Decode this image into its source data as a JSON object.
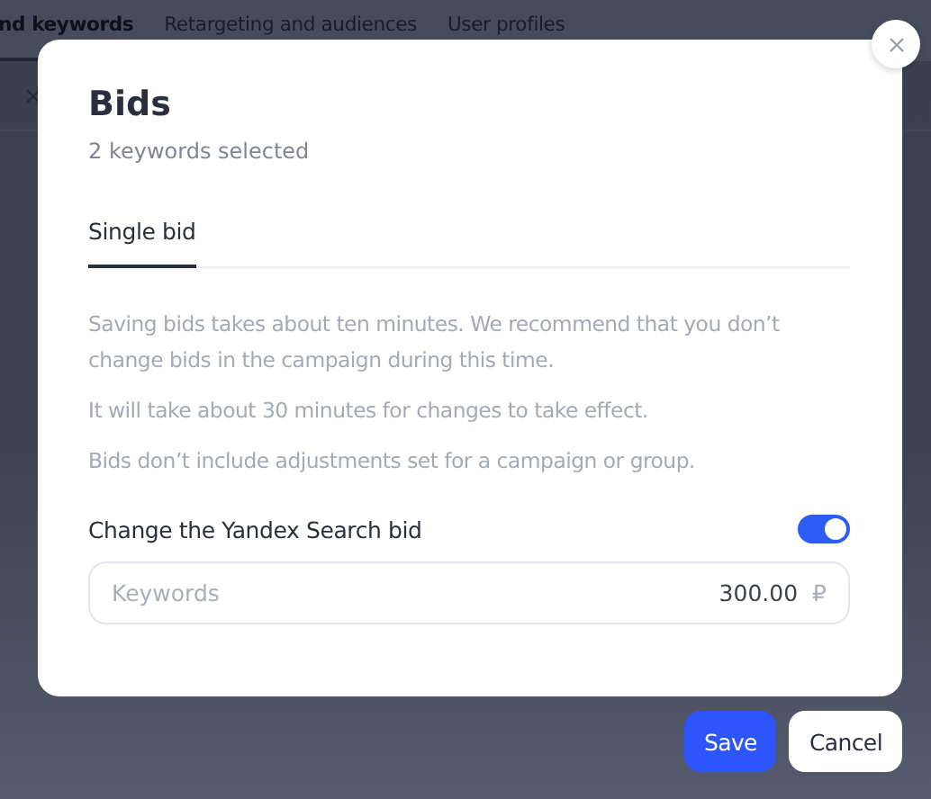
{
  "background": {
    "tabs": [
      {
        "label": "nd keywords",
        "selected": true
      },
      {
        "label": "Retargeting and audiences",
        "selected": false
      },
      {
        "label": "User profiles",
        "selected": false
      }
    ]
  },
  "dialog": {
    "title": "Bids",
    "subtitle": "2 keywords selected",
    "tabs": [
      {
        "label": "Single bid",
        "selected": true
      }
    ],
    "notes": [
      "Saving bids takes about ten minutes. We recommend that you don’t change bids in the campaign during this time.",
      "It will take about 30 minutes for changes to take effect.",
      "Bids don’t include adjustments set for a campaign or group."
    ],
    "toggle": {
      "label": "Change the Yandex Search bid",
      "on": true
    },
    "field": {
      "label": "Keywords",
      "value": "300.00",
      "currency": "₽"
    }
  },
  "buttons": [
    {
      "label": "Save",
      "kind": "primary"
    },
    {
      "label": "Cancel",
      "kind": "secondary"
    }
  ]
}
